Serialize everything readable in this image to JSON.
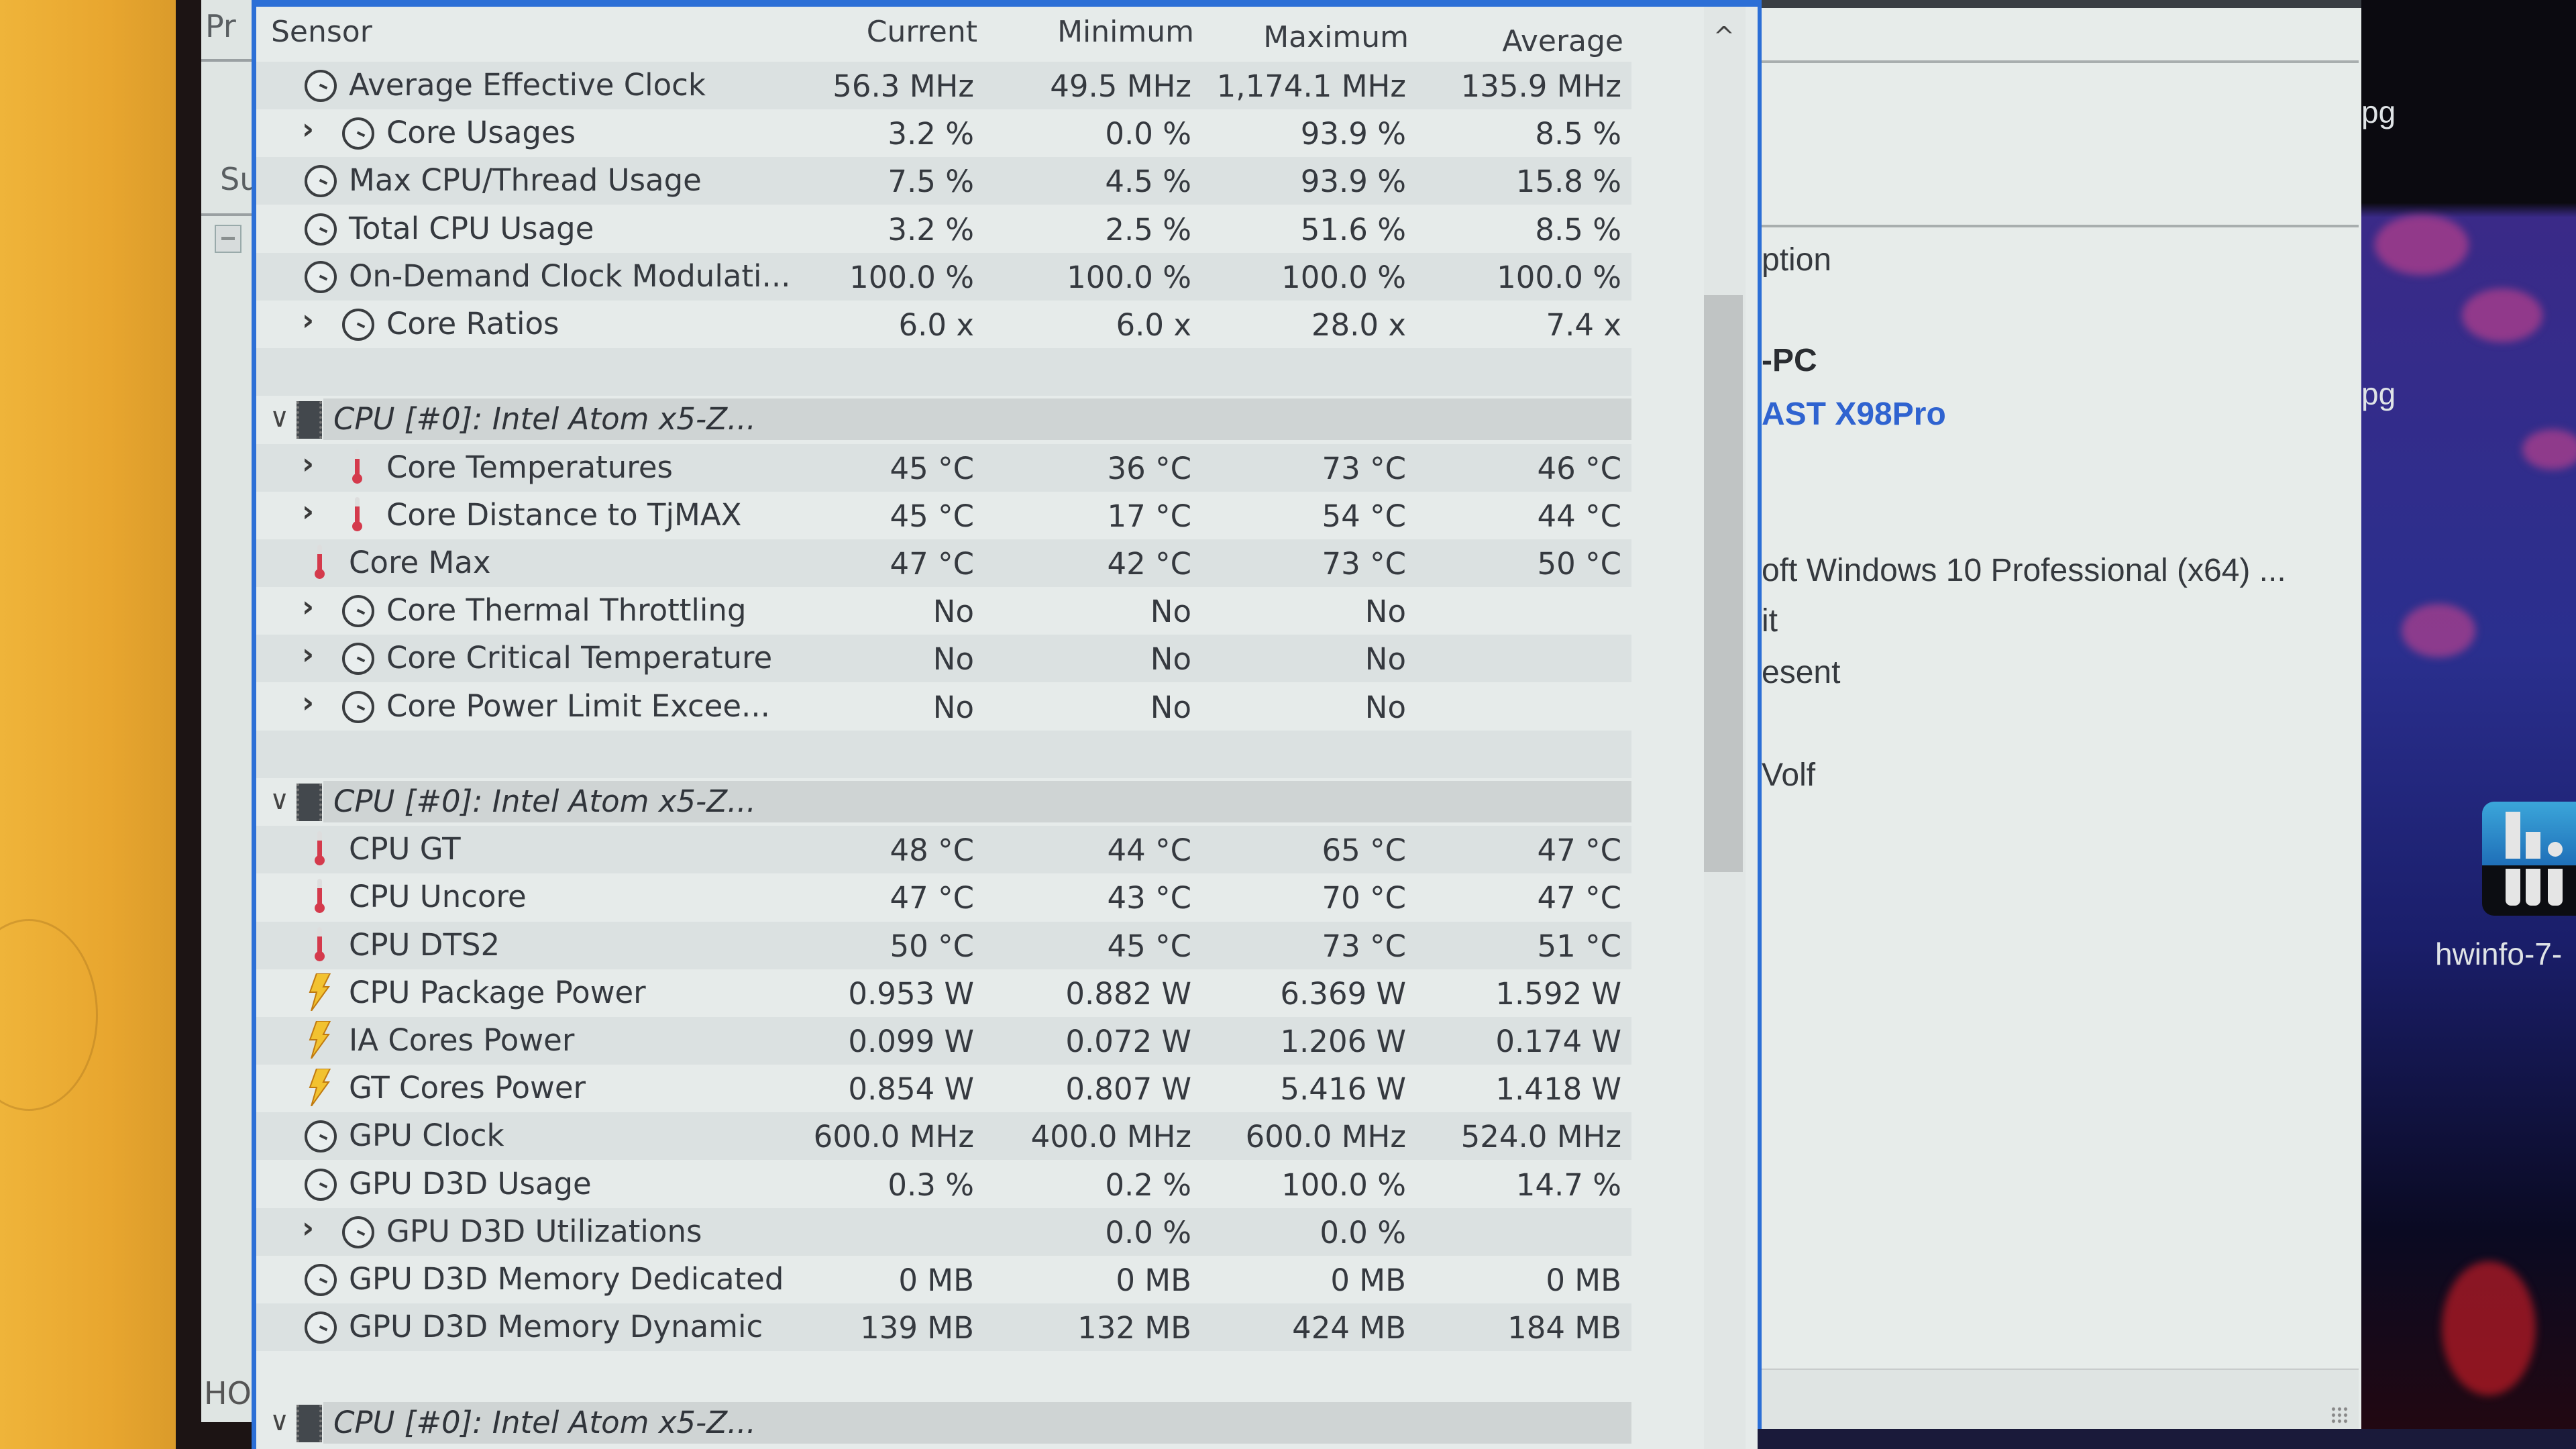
{
  "background_window": {
    "tab_fragment_top": "Pr",
    "tab_fragment_mid": "Su",
    "bottom_fragment": "HO"
  },
  "sensor_window": {
    "columns": {
      "sensor": "Sensor",
      "current": "Current",
      "minimum": "Minimum",
      "maximum": "Maximum",
      "average": "Average"
    },
    "rows": [
      {
        "type": "sensor",
        "icon": "clock-icon",
        "expandable": false,
        "indent": 1,
        "name": "Average Effective Clock",
        "current": "56.3 MHz",
        "minimum": "49.5 MHz",
        "maximum": "1,174.1 MHz",
        "average": "135.9 MHz"
      },
      {
        "type": "sensor",
        "icon": "clock-icon",
        "expandable": true,
        "indent": 2,
        "name": "Core Usages",
        "current": "3.2 %",
        "minimum": "0.0 %",
        "maximum": "93.9 %",
        "average": "8.5 %"
      },
      {
        "type": "sensor",
        "icon": "clock-icon",
        "expandable": false,
        "indent": 1,
        "name": "Max CPU/Thread Usage",
        "current": "7.5 %",
        "minimum": "4.5 %",
        "maximum": "93.9 %",
        "average": "15.8 %"
      },
      {
        "type": "sensor",
        "icon": "clock-icon",
        "expandable": false,
        "indent": 1,
        "name": "Total CPU Usage",
        "current": "3.2 %",
        "minimum": "2.5 %",
        "maximum": "51.6 %",
        "average": "8.5 %"
      },
      {
        "type": "sensor",
        "icon": "clock-icon",
        "expandable": false,
        "indent": 1,
        "name": "On-Demand Clock Modulati...",
        "current": "100.0 %",
        "minimum": "100.0 %",
        "maximum": "100.0 %",
        "average": "100.0 %"
      },
      {
        "type": "sensor",
        "icon": "clock-icon",
        "expandable": true,
        "indent": 2,
        "name": "Core Ratios",
        "current": "6.0 x",
        "minimum": "6.0 x",
        "maximum": "28.0 x",
        "average": "7.4 x"
      },
      {
        "type": "blank"
      },
      {
        "type": "group",
        "icon": "cpu-chip-icon",
        "name": "CPU [#0]: Intel Atom x5-Z..."
      },
      {
        "type": "sensor",
        "icon": "thermometer-icon",
        "expandable": true,
        "indent": 2,
        "name": "Core Temperatures",
        "current": "45 °C",
        "minimum": "36 °C",
        "maximum": "73 °C",
        "average": "46 °C"
      },
      {
        "type": "sensor",
        "icon": "thermometer-icon",
        "expandable": true,
        "indent": 2,
        "name": "Core Distance to TjMAX",
        "current": "45 °C",
        "minimum": "17 °C",
        "maximum": "54 °C",
        "average": "44 °C"
      },
      {
        "type": "sensor",
        "icon": "thermometer-icon",
        "expandable": false,
        "indent": 1,
        "name": "Core Max",
        "current": "47 °C",
        "minimum": "42 °C",
        "maximum": "73 °C",
        "average": "50 °C"
      },
      {
        "type": "sensor",
        "icon": "clock-icon",
        "expandable": true,
        "indent": 2,
        "name": "Core Thermal Throttling",
        "current": "No",
        "minimum": "No",
        "maximum": "No",
        "average": ""
      },
      {
        "type": "sensor",
        "icon": "clock-icon",
        "expandable": true,
        "indent": 2,
        "name": "Core Critical Temperature",
        "current": "No",
        "minimum": "No",
        "maximum": "No",
        "average": ""
      },
      {
        "type": "sensor",
        "icon": "clock-icon",
        "expandable": true,
        "indent": 2,
        "name": "Core Power Limit Excee...",
        "current": "No",
        "minimum": "No",
        "maximum": "No",
        "average": ""
      },
      {
        "type": "blank"
      },
      {
        "type": "group",
        "icon": "cpu-chip-icon",
        "name": "CPU [#0]: Intel Atom x5-Z..."
      },
      {
        "type": "sensor",
        "icon": "thermometer-icon",
        "expandable": false,
        "indent": 1,
        "name": "CPU GT",
        "current": "48 °C",
        "minimum": "44 °C",
        "maximum": "65 °C",
        "average": "47 °C"
      },
      {
        "type": "sensor",
        "icon": "thermometer-icon",
        "expandable": false,
        "indent": 1,
        "name": "CPU Uncore",
        "current": "47 °C",
        "minimum": "43 °C",
        "maximum": "70 °C",
        "average": "47 °C"
      },
      {
        "type": "sensor",
        "icon": "thermometer-icon",
        "expandable": false,
        "indent": 1,
        "name": "CPU DTS2",
        "current": "50 °C",
        "minimum": "45 °C",
        "maximum": "73 °C",
        "average": "51 °C"
      },
      {
        "type": "sensor",
        "icon": "power-bolt-icon",
        "expandable": false,
        "indent": 1,
        "name": "CPU Package Power",
        "current": "0.953 W",
        "minimum": "0.882 W",
        "maximum": "6.369 W",
        "average": "1.592 W"
      },
      {
        "type": "sensor",
        "icon": "power-bolt-icon",
        "expandable": false,
        "indent": 1,
        "name": "IA Cores Power",
        "current": "0.099 W",
        "minimum": "0.072 W",
        "maximum": "1.206 W",
        "average": "0.174 W"
      },
      {
        "type": "sensor",
        "icon": "power-bolt-icon",
        "expandable": false,
        "indent": 1,
        "name": "GT Cores Power",
        "current": "0.854 W",
        "minimum": "0.807 W",
        "maximum": "5.416 W",
        "average": "1.418 W"
      },
      {
        "type": "sensor",
        "icon": "clock-icon",
        "expandable": false,
        "indent": 1,
        "name": "GPU Clock",
        "current": "600.0 MHz",
        "minimum": "400.0 MHz",
        "maximum": "600.0 MHz",
        "average": "524.0 MHz"
      },
      {
        "type": "sensor",
        "icon": "clock-icon",
        "expandable": false,
        "indent": 1,
        "name": "GPU D3D Usage",
        "current": "0.3 %",
        "minimum": "0.2 %",
        "maximum": "100.0 %",
        "average": "14.7 %"
      },
      {
        "type": "sensor",
        "icon": "clock-icon",
        "expandable": true,
        "indent": 2,
        "name": "GPU D3D Utilizations",
        "current": "",
        "minimum": "0.0 %",
        "maximum": "0.0 %",
        "average": ""
      },
      {
        "type": "sensor",
        "icon": "clock-icon",
        "expandable": false,
        "indent": 1,
        "name": "GPU D3D Memory Dedicated",
        "current": "0 MB",
        "minimum": "0 MB",
        "maximum": "0 MB",
        "average": "0 MB"
      },
      {
        "type": "sensor",
        "icon": "clock-icon",
        "expandable": false,
        "indent": 1,
        "name": "GPU D3D Memory Dynamic",
        "current": "139 MB",
        "minimum": "132 MB",
        "maximum": "424 MB",
        "average": "184 MB"
      },
      {
        "type": "blank"
      },
      {
        "type": "group",
        "icon": "cpu-chip-icon",
        "name": "CPU [#0]: Intel Atom x5-Z..."
      }
    ],
    "scrollbar": {
      "up_arrow": "^"
    }
  },
  "right_window": {
    "lines": [
      {
        "text": "ption",
        "style": "normal"
      },
      {
        "text": "-PC",
        "style": "bold"
      },
      {
        "text": "AST X98Pro",
        "style": "blue"
      },
      {
        "text": "oft Windows 10 Professional (x64) ...",
        "style": "normal"
      },
      {
        "text": "it",
        "style": "normal"
      },
      {
        "text": "esent",
        "style": "normal"
      },
      {
        "text": "Volf",
        "style": "normal"
      }
    ]
  },
  "desktop": {
    "labels": [
      "pg",
      "pg"
    ],
    "icon_label": "hwinfo-7-"
  },
  "colors": {
    "window_border": "#2c6fd6",
    "thermometer": "#d43a4c",
    "link_blue": "#2f63d0",
    "bolt_yellow": "#f2c230"
  }
}
